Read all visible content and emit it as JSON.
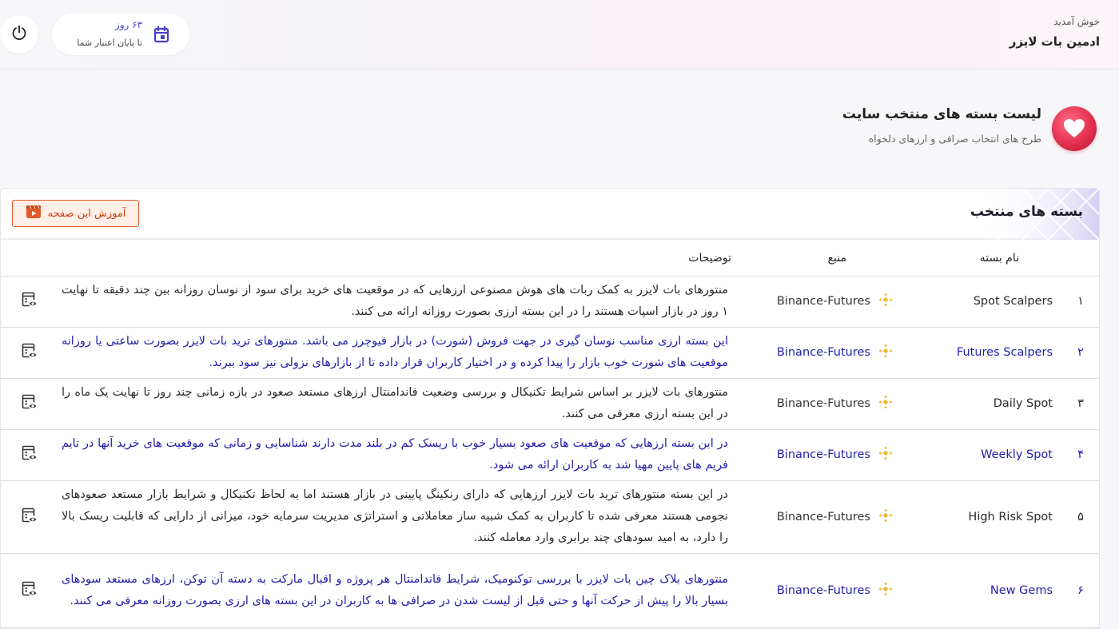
{
  "header": {
    "welcome": "خوش آمدید",
    "user_name": "ادمین بات لایزر",
    "subscription_days": "۶۳ روز",
    "subscription_label": "تا پایان اعتبار شما"
  },
  "page": {
    "title": "لیست بسته های منتخب سایت",
    "subtitle": "طرح های انتخاب صرافی و ارزهای دلخواه"
  },
  "card": {
    "title": "بسته های منتخب",
    "tutorial_button": "آموزش این صفحه"
  },
  "table": {
    "columns": [
      "نام بسته",
      "منبع",
      "توضیحات"
    ],
    "rows": [
      {
        "index": "۱",
        "name": "Spot Scalpers",
        "source": "Binance-Futures",
        "description": "منتورهای بات لایزر به کمک ربات های هوش مصنوعی ارزهایی که در موقعیت های خرید برای سود از نوسان روزانه بین چند دقیقه تا نهایت ۱ روز در بازار اسپات هستند را در این بسته ارزی بصورت روزانه ارائه می کنند."
      },
      {
        "index": "۲",
        "name": "Futures Scalpers",
        "source": "Binance-Futures",
        "description": "این بسته ارزی مناسب نوسان گیری در جهت فروش (شورت) در بازار فیوچرز می باشد. منتورهای ترید بات لایزر بصورت ساعتی یا روزانه موقعیت های شورت خوب بازار را پیدا کرده و در اختیار کاربران قرار داده تا از بازارهای نزولی نیز سود ببرند."
      },
      {
        "index": "۳",
        "name": "Daily Spot",
        "source": "Binance-Futures",
        "description": "منتورهای بات لایزر بر اساس شرایط تکنیکال و بررسی وضعیت فاندامنتال ارزهای مستعد صعود در بازه زمانی چند روز تا نهایت یک ماه را در این بسته ارزی معرفی می کنند."
      },
      {
        "index": "۴",
        "name": "Weekly Spot",
        "source": "Binance-Futures",
        "description": "در این بسته ارزهایی که موقعیت های صعود بسیار خوب با ریسک کم در بلند مدت دارند شناسایی و زمانی که موقعیت های خرید آنها در تایم فریم های پایین مهیا شد به کاربران ارائه می شود."
      },
      {
        "index": "۵",
        "name": "High Risk Spot",
        "source": "Binance-Futures",
        "description": "در این بسته منتورهای ترید بات لایزر ارزهایی که دارای رنکینگ پایینی در بازار هستند اما به لحاظ تکنیکال و شرایط بازار مستعد صعودهای نجومی هستند معرفی شده تا کاربران به کمک شبیه ساز معاملاتی و استراتژی مدیریت سرمایه خود، میزانی از دارایی که قابلیت ریسک بالا را دارد، به امید سودهای چند برابری وارد معامله کنند."
      },
      {
        "index": "۶",
        "name": "New Gems",
        "source": "Binance-Futures",
        "description": "منتورهای بلاک چین بات لایزر با بررسی توکنومیک، شرایط فاندامنتال هر پروژه و اقبال مارکت به دسته آن توکن، ارزهای مستعد سودهای بسیار بالا را پیش از حرکت آنها و حتی قبل از لیست شدن در صرافی ها به کاربران در این بسته های ارزی بصورت روزانه معرفی می کنند."
      }
    ]
  },
  "icons": {
    "power": "power-icon",
    "calendar": "calendar-icon",
    "heart": "heart-icon",
    "tutorial": "video-icon",
    "source": "binance-icon",
    "row_action": "view-list-icon"
  },
  "colors": {
    "accent": "#4a3fcf",
    "link_row_text": "#2420a8",
    "tutorial": "#e25a2c",
    "heart": "#e3304f",
    "binance": "#f3ba2f"
  }
}
